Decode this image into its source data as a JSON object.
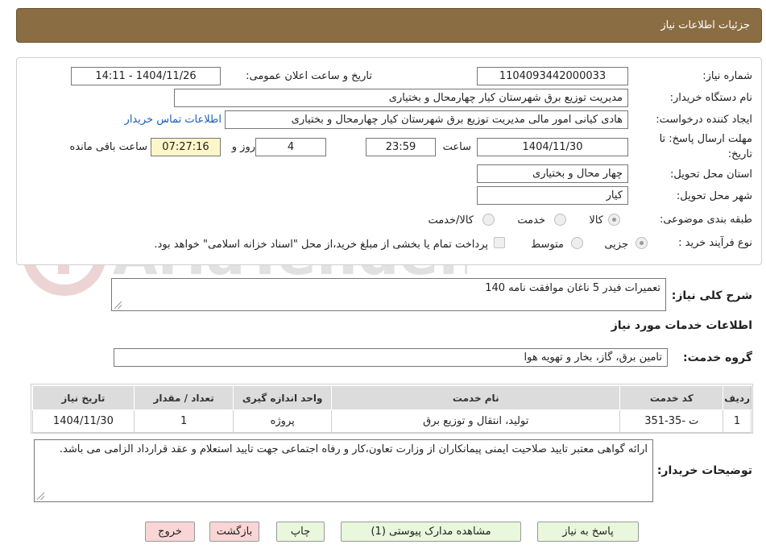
{
  "header": {
    "title": "جزئیات اطلاعات نیاز"
  },
  "fields": {
    "need_number_label": "شماره نیاز:",
    "need_number": "1104093442000033",
    "announce_label": "تاریخ و ساعت اعلان عمومی:",
    "announce_value": "1404/11/26 - 14:11",
    "buyer_org_label": "نام دستگاه خریدار:",
    "buyer_org": "مدیریت توزیع برق شهرستان کیار چهارمحال و بختیاری",
    "creator_label": "ایجاد کننده درخواست:",
    "creator": "هادی کیانی امور مالی مدیریت توزیع برق شهرستان کیار چهارمحال و بختیاری",
    "contact_link": "اطلاعات تماس خریدار",
    "deadline_label_1": "مهلت ارسال پاسخ: تا",
    "deadline_label_2": "تاریخ:",
    "deadline_date": "1404/11/30",
    "time_label": "ساعت",
    "deadline_time": "23:59",
    "days": "4",
    "days_label": "روز و",
    "remaining": "07:27:16",
    "remaining_label": "ساعت باقی مانده",
    "province_label": "استان محل تحویل:",
    "province": "چهار محال و بختیاری",
    "city_label": "شهر محل تحویل:",
    "city": "کیار",
    "category_label": "طبقه بندی موضوعی:",
    "category_options": [
      "کالا",
      "خدمت",
      "کالا/خدمت"
    ],
    "category_selected": "کالا",
    "process_label": "نوع فرآیند خرید :",
    "process_options": [
      "جزیی",
      "متوسط"
    ],
    "process_selected": "جزیی",
    "payment_note": "پرداخت تمام یا بخشی از مبلغ خرید،از محل \"اسناد خزانه اسلامی\" خواهد بود."
  },
  "summary": {
    "label": "شرح کلی نیاز:",
    "value": "تعمیرات فیدر 5 ناغان موافقت نامه 140"
  },
  "services_section": {
    "title": "اطلاعات خدمات مورد نیاز",
    "group_label": "گروه خدمت:",
    "group_value": "تامین برق، گاز، بخار و تهویه هوا"
  },
  "table": {
    "headers": [
      "ردیف",
      "کد خدمت",
      "نام خدمت",
      "واحد اندازه گیری",
      "تعداد / مقدار",
      "تاریخ نیاز"
    ],
    "rows": [
      [
        "1",
        "ت -35-351",
        "تولید، انتقال و توزیع برق",
        "پروژه",
        "1",
        "1404/11/30"
      ]
    ]
  },
  "buyer_notes": {
    "label": "توضیحات خریدار:",
    "value": "ارائه گواهی معتبر تایید صلاحیت ایمنی پیمانکاران از وزارت تعاون،کار و رفاه اجتماعی جهت تایید استعلام و عقد قرارداد الزامی می باشد."
  },
  "buttons": {
    "reply": "پاسخ به نیاز",
    "attachments": "مشاهده مدارک پیوستی (1)",
    "print": "چاپ",
    "back": "بازگشت",
    "exit": "خروج"
  },
  "watermark": {
    "text": "AriaTender.neT"
  },
  "colors": {
    "header_bg": "#8b6d43",
    "button_green": "#e9f7dc",
    "button_red": "#f9d5d5",
    "remaining_bg": "#fdf6c9",
    "link": "#1a5fb4"
  }
}
